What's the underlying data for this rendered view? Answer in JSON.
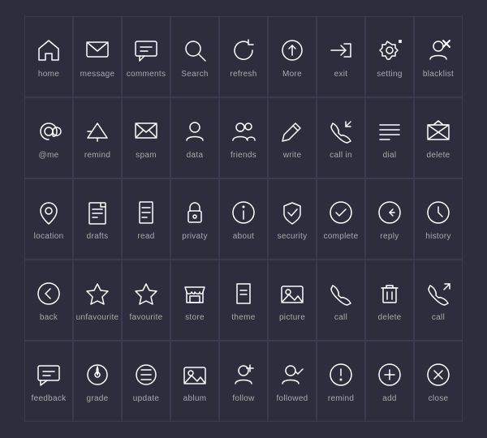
{
  "icons": [
    {
      "name": "home-icon",
      "label": "home",
      "interactable": true
    },
    {
      "name": "message-icon",
      "label": "message",
      "interactable": true
    },
    {
      "name": "comments-icon",
      "label": "comments",
      "interactable": true
    },
    {
      "name": "search-icon",
      "label": "search",
      "interactable": true
    },
    {
      "name": "refresh-icon",
      "label": "refresh",
      "interactable": true
    },
    {
      "name": "more-icon",
      "label": "more",
      "interactable": true
    },
    {
      "name": "exit-icon",
      "label": "exit",
      "interactable": true
    },
    {
      "name": "setting-icon",
      "label": "setting",
      "interactable": true
    },
    {
      "name": "blacklist-icon",
      "label": "blacklist",
      "interactable": true
    },
    {
      "name": "atme-icon",
      "label": "@me",
      "interactable": true
    },
    {
      "name": "remind-icon",
      "label": "remind",
      "interactable": true
    },
    {
      "name": "spam-icon",
      "label": "spam",
      "interactable": true
    },
    {
      "name": "data-icon",
      "label": "data",
      "interactable": true
    },
    {
      "name": "friends-icon",
      "label": "friends",
      "interactable": true
    },
    {
      "name": "write-icon",
      "label": "write",
      "interactable": true
    },
    {
      "name": "callin-icon",
      "label": "call in",
      "interactable": true
    },
    {
      "name": "dial-icon",
      "label": "dial",
      "interactable": true
    },
    {
      "name": "delete-icon",
      "label": "delete",
      "interactable": true
    },
    {
      "name": "location-icon",
      "label": "location",
      "interactable": true
    },
    {
      "name": "drafts-icon",
      "label": "drafts",
      "interactable": true
    },
    {
      "name": "read-icon",
      "label": "read",
      "interactable": true
    },
    {
      "name": "privacy-icon",
      "label": "privaty",
      "interactable": true
    },
    {
      "name": "about-icon",
      "label": "about",
      "interactable": true
    },
    {
      "name": "security-icon",
      "label": "security",
      "interactable": true
    },
    {
      "name": "complete-icon",
      "label": "complete",
      "interactable": true
    },
    {
      "name": "reply-icon",
      "label": "reply",
      "interactable": true
    },
    {
      "name": "history-icon",
      "label": "history",
      "interactable": true
    },
    {
      "name": "back-icon",
      "label": "back",
      "interactable": true
    },
    {
      "name": "unfavourite-icon",
      "label": "unfavourite",
      "interactable": true
    },
    {
      "name": "favourite-icon",
      "label": "favourite",
      "interactable": true
    },
    {
      "name": "store-icon",
      "label": "store",
      "interactable": true
    },
    {
      "name": "theme-icon",
      "label": "theme",
      "interactable": true
    },
    {
      "name": "picture-icon",
      "label": "picture",
      "interactable": true
    },
    {
      "name": "call-icon",
      "label": "call",
      "interactable": true
    },
    {
      "name": "delete2-icon",
      "label": "delete",
      "interactable": true
    },
    {
      "name": "call2-icon",
      "label": "call",
      "interactable": true
    },
    {
      "name": "feedback-icon",
      "label": "feedback",
      "interactable": true
    },
    {
      "name": "grade-icon",
      "label": "grade",
      "interactable": true
    },
    {
      "name": "update-icon",
      "label": "update",
      "interactable": true
    },
    {
      "name": "ablum-icon",
      "label": "ablum",
      "interactable": true
    },
    {
      "name": "follow-icon",
      "label": "follow",
      "interactable": true
    },
    {
      "name": "followed-icon",
      "label": "followed",
      "interactable": true
    },
    {
      "name": "remind2-icon",
      "label": "remind",
      "interactable": true
    },
    {
      "name": "add-icon",
      "label": "add",
      "interactable": true
    },
    {
      "name": "close-icon",
      "label": "close",
      "interactable": true
    }
  ]
}
